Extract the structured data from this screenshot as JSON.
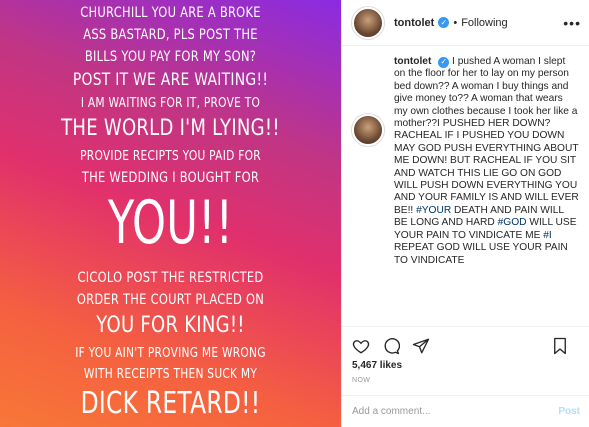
{
  "media": {
    "lines": [
      "CHURCHILL YOU ARE A BROKE",
      "ASS BASTARD, PLS POST THE",
      "BILLS YOU PAY FOR MY SON?",
      "POST IT WE ARE WAITING!!",
      "I AM WAITING FOR IT, PROVE TO",
      "THE WORLD I'M LYING!!",
      "PROVIDE RECIPTS YOU PAID FOR",
      "THE WEDDING I BOUGHT FOR",
      "YOU!!",
      "CICOLO POST THE RESTRICTED",
      "ORDER THE COURT PLACED ON",
      "YOU FOR KING!!",
      "IF YOU AIN'T PROVING ME WRONG",
      "WITH RECEIPTS THEN SUCK MY",
      "DICK RETARD!!"
    ]
  },
  "header": {
    "username": "tontolet",
    "verified_icon": "verified-badge-icon",
    "separator": "•",
    "follow_status": "Following",
    "more_label": "•••"
  },
  "caption": {
    "username": "tontolet",
    "verified_icon": "verified-badge-icon",
    "text_1": " I pushed A woman I slept on the floor for her to lay on my person bed down?? A woman I buy things and give money to?? A woman that wears my own clothes because I took her like a mother??I PUSHED HER DOWN? RACHEAL IF I PUSHED YOU DOWN MAY GOD PUSH EVERYTHING ABOUT ME DOWN! BUT RACHEAL IF YOU SIT AND WATCH THIS LIE GO ON GOD WILL PUSH DOWN EVERYTHING YOU AND YOUR FAMILY IS AND WILL EVER BE!! ",
    "tag_1": "#YOUR",
    "text_2": " DEATH AND PAIN WILL BE LONG AND HARD ",
    "tag_2": "#GOD",
    "text_3": " WILL USE YOUR PAIN TO VINDICATE ME ",
    "tag_3": "#I",
    "text_4": " REPEAT GOD WILL USE YOUR PAIN TO VINDICATE"
  },
  "actions": {
    "like_icon": "heart-icon",
    "comment_icon": "comment-icon",
    "share_icon": "share-icon",
    "save_icon": "bookmark-icon",
    "likes": "5,467 likes",
    "timestamp": "NOW"
  },
  "comment_box": {
    "placeholder": "Add a comment...",
    "post_label": "Post"
  },
  "colors": {
    "link": "#003569",
    "verified": "#3897f0",
    "post_disabled": "#b2dffc"
  }
}
